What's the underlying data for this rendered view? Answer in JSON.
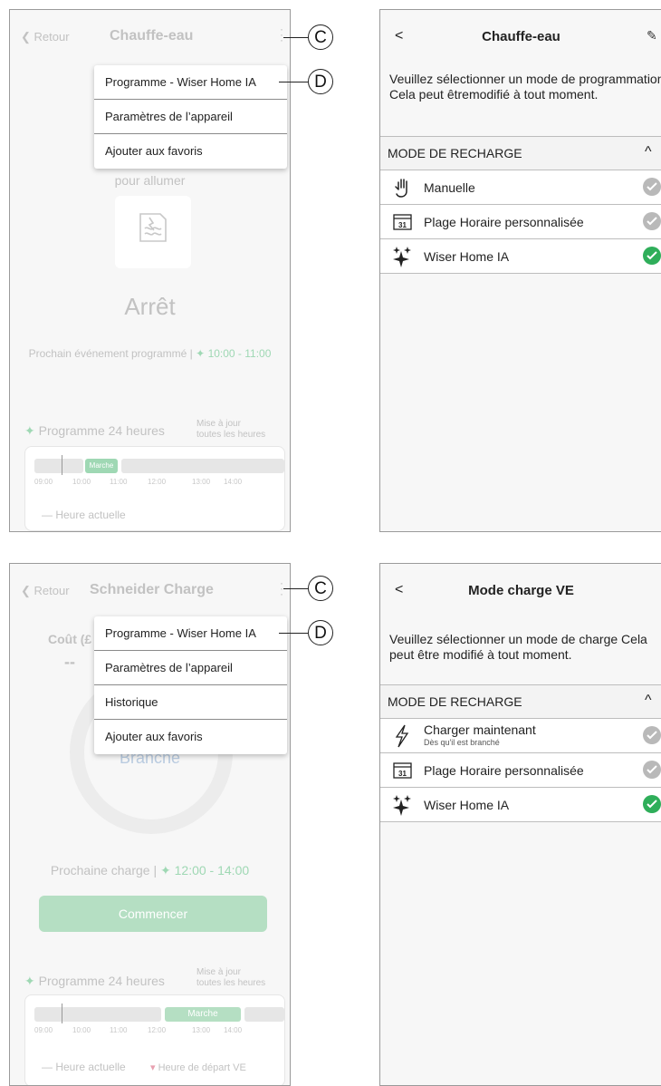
{
  "panel1": {
    "back_label": "Retour",
    "title": "Chauffe-eau",
    "menu": [
      "Programme - Wiser Home IA",
      "Paramètres de l’appareil",
      "Ajouter aux favoris"
    ],
    "hint": "pour allumer",
    "state": "Arrêt",
    "next_event_label": "Prochain événement programmé |",
    "next_event_time": "10:00 - 11:00",
    "schedule_title": "Programme 24 heures",
    "update_note_1": "Mise à jour",
    "update_note_2": "toutes les heures",
    "on_label": "Marche",
    "ticks": [
      "09:00",
      "10:00",
      "11:00",
      "12:00",
      "13:00",
      "14:00"
    ],
    "legend_current": "— Heure actuelle"
  },
  "panel2": {
    "title": "Chauffe-eau",
    "description": "Veuillez sélectionner un mode de programmation. Cela peut êtremodifié à tout moment.",
    "section": "MODE DE RECHARGE",
    "options": [
      {
        "label": "Manuelle",
        "icon": "hand-icon",
        "selected": false
      },
      {
        "label": "Plage Horaire personnalisée",
        "icon": "calendar-icon",
        "selected": false
      },
      {
        "label": "Wiser Home IA",
        "icon": "sparkle-icon",
        "selected": true
      }
    ]
  },
  "panel3": {
    "back_label": "Retour",
    "title": "Schneider Charge",
    "cost_label": "Coût (£",
    "cost_value": "--",
    "menu": [
      "Programme - Wiser Home IA",
      "Paramètres de l’appareil",
      "Historique",
      "Ajouter aux favoris"
    ],
    "state": "Branché",
    "next_charge_label": "Prochaine charge |",
    "next_charge_time": "12:00 - 14:00",
    "start_button": "Commencer",
    "schedule_title": "Programme 24 heures",
    "update_note_1": "Mise à jour",
    "update_note_2": "toutes les heures",
    "on_label": "Marche",
    "ticks": [
      "09:00",
      "10:00",
      "11:00",
      "12:00",
      "13:00",
      "14:00"
    ],
    "legend_current": "— Heure actuelle",
    "legend_departure": "Heure de départ VE"
  },
  "panel4": {
    "title": "Mode charge VE",
    "description": "Veuillez sélectionner un mode de charge Cela peut être modifié à tout moment.",
    "section": "MODE DE RECHARGE",
    "options": [
      {
        "label": "Charger maintenant",
        "sublabel": "Dès qu'il est branché",
        "icon": "lightning-icon",
        "selected": false
      },
      {
        "label": "Plage Horaire personnalisée",
        "icon": "calendar-icon",
        "selected": false
      },
      {
        "label": "Wiser Home IA",
        "icon": "sparkle-icon",
        "selected": true
      }
    ]
  },
  "callouts": {
    "c": "C",
    "d": "D"
  },
  "colors": {
    "accent_green": "#2fae5a",
    "faded_green": "#9fd8b4",
    "button_green": "#b5dfc3"
  }
}
